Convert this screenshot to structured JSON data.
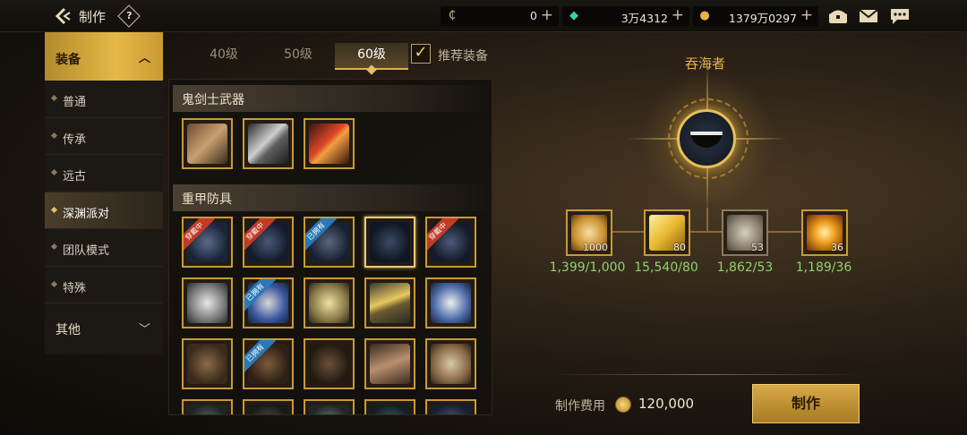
{
  "header": {
    "title": "制作",
    "help_label": "?",
    "currencies": [
      {
        "icon": "c-coin-icon",
        "symbol": "₵",
        "value": "0"
      },
      {
        "icon": "gem-icon",
        "symbol": "◆",
        "value": "3万4312"
      },
      {
        "icon": "gold-coin-icon",
        "symbol": "●",
        "value": "1379万0297"
      }
    ],
    "plus": "+"
  },
  "nav": {
    "head": "装备",
    "items": [
      "普通",
      "传承",
      "远古",
      "深渊派对",
      "团队模式",
      "特殊"
    ],
    "active_index": 3,
    "other": "其他"
  },
  "tabs": [
    "40级",
    "50级",
    "60级"
  ],
  "active_tab": 2,
  "recommend_label": "推荐装备",
  "sections": {
    "weapon": "鬼剑士武器",
    "armor": "重甲防具"
  },
  "ribbons": {
    "equipped": "穿戴中",
    "obtained": "已拥有"
  },
  "detail": {
    "item_name": "吞海者",
    "materials": [
      {
        "icon": "crystal-shard-icon",
        "required": "1000",
        "owned": "1,399/1,000"
      },
      {
        "icon": "gold-cube-icon",
        "required": "80",
        "owned": "15,540/80"
      },
      {
        "icon": "stone-icon",
        "required": "53",
        "owned": "1,862/53"
      },
      {
        "icon": "fire-orb-icon",
        "required": "36",
        "owned": "1,189/36"
      }
    ],
    "cost_label": "制作费用",
    "cost_value": "120,000",
    "craft_button": "制作"
  },
  "colors": {
    "accent_gold": "#e0b04a",
    "owned_green": "#8ed36a",
    "equipped_red": "#c23a28",
    "obtained_blue": "#2a78b8"
  }
}
